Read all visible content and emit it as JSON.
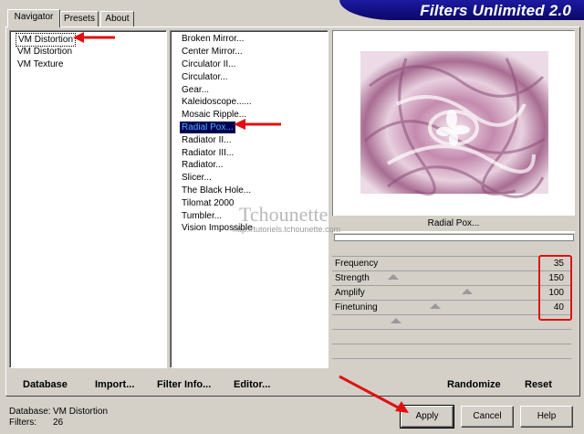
{
  "tabs": [
    {
      "label": "Navigator"
    },
    {
      "label": "Presets"
    },
    {
      "label": "About"
    }
  ],
  "banner": {
    "title": "Filters Unlimited 2.0"
  },
  "categories": [
    {
      "label": "VM Distortion",
      "selected": true
    },
    {
      "label": "VM Distortion"
    },
    {
      "label": "VM Texture"
    }
  ],
  "filters": [
    {
      "label": "Broken Mirror..."
    },
    {
      "label": "Center Mirror..."
    },
    {
      "label": "Circulator II..."
    },
    {
      "label": "Circulator..."
    },
    {
      "label": "Gear..."
    },
    {
      "label": "Kaleidoscope......"
    },
    {
      "label": "Mosaic Ripple..."
    },
    {
      "label": "Radial Pox...",
      "selected": true
    },
    {
      "label": "Radiator II..."
    },
    {
      "label": "Radiator III..."
    },
    {
      "label": "Radiator..."
    },
    {
      "label": "Slicer..."
    },
    {
      "label": "The Black Hole..."
    },
    {
      "label": "Tilomat 2000"
    },
    {
      "label": "Tumbler..."
    },
    {
      "label": "Vision Impossible"
    }
  ],
  "preview": {
    "filter_name": "Radial Pox..."
  },
  "watermark": {
    "title": "Tchounette",
    "subtitle": "http://tutoriels.tchounette.com"
  },
  "params": [
    {
      "label": "Frequency",
      "value": "35",
      "level": 0.137
    },
    {
      "label": "Strength",
      "value": "150",
      "level": 0.588
    },
    {
      "label": "Amplify",
      "value": "100",
      "level": 0.392
    },
    {
      "label": "Finetuning",
      "value": "40",
      "level": 0.157
    }
  ],
  "toolbar": {
    "database": "Database",
    "import": "Import...",
    "filter_info": "Filter Info...",
    "editor": "Editor...",
    "randomize": "Randomize",
    "reset": "Reset"
  },
  "status": {
    "database_label": "Database:",
    "database_value": "VM Distortion",
    "filters_label": "Filters:",
    "filters_value": "26"
  },
  "buttons": {
    "apply": "Apply",
    "cancel": "Cancel",
    "help": "Help"
  },
  "colors": {
    "annotation": "#e01010",
    "banner": "#0a0868",
    "selection": "#000050"
  }
}
